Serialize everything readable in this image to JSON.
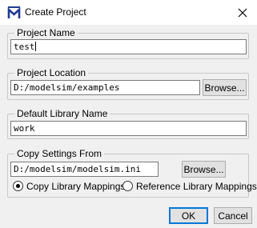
{
  "window": {
    "title": "Create Project",
    "icon": "modelsim-m-icon",
    "close_icon": "close-icon"
  },
  "project_name": {
    "label": "Project Name",
    "value": "test"
  },
  "project_location": {
    "label": "Project Location",
    "value": "D:/modelsim/examples",
    "browse_label": "Browse..."
  },
  "default_library": {
    "label": "Default Library Name",
    "value": "work"
  },
  "copy_settings": {
    "label": "Copy Settings From",
    "value": "D:/modelsim/modelsim.ini",
    "browse_label": "Browse...",
    "options": [
      {
        "label": "Copy Library Mappings",
        "selected": true
      },
      {
        "label": "Reference Library Mappings",
        "selected": false
      }
    ]
  },
  "buttons": {
    "ok": "OK",
    "cancel": "Cancel"
  },
  "colors": {
    "dialog_bg": "#f0f0f0",
    "titlebar_bg": "#ffffff",
    "icon_blue": "#1f3a93",
    "default_button_border": "#0078d7"
  }
}
